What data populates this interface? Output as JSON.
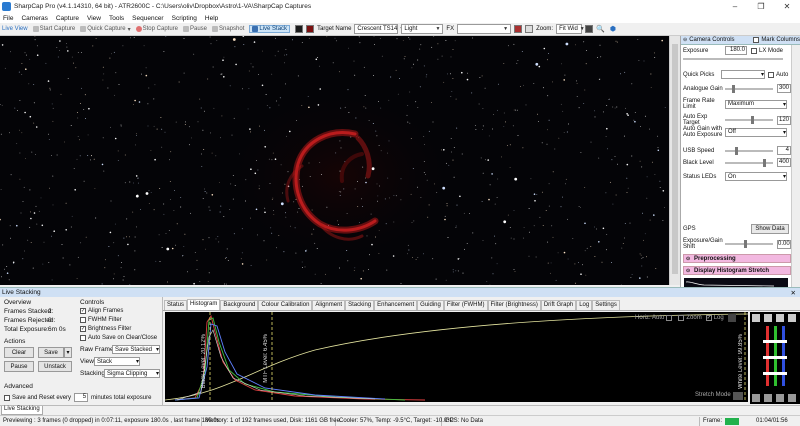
{
  "window": {
    "title": "SharpCap Pro (v4.1.14310, 64 bit) - ATR2600C - C:\\Users\\oliv\\Dropbox\\Astro\\1-VA\\SharpCap Captures",
    "minimize": "–",
    "maximize": "❐",
    "close": "✕"
  },
  "menu": [
    "File",
    "Cameras",
    "Capture",
    "View",
    "Tools",
    "Sequencer",
    "Scripting",
    "Help"
  ],
  "toolbar": {
    "live_view": "Live View",
    "start_capture": "Start Capture",
    "quick_capture": "Quick Capture",
    "stop_capture": "Stop Capture",
    "pause": "Pause",
    "snapshot": "Snapshot",
    "live_stack": "Live Stack",
    "target_label": "Target Name",
    "target_value": "Crescent TS14",
    "frame_type": "Light",
    "fx_label": "FX",
    "fx_value": "",
    "zoom_label": "Zoom:",
    "zoom_value": "Fit Wid"
  },
  "camera_controls": {
    "header": "Camera Controls",
    "mark_columns": "Mark Columns",
    "exposure_label": "Exposure",
    "exposure_value": "180.0",
    "lx_mode": "LX Mode",
    "quick_picks_label": "Quick Picks",
    "quick_picks_value": "",
    "auto_label": "Auto",
    "rows": [
      {
        "label": "Analogue Gain",
        "value": "300",
        "kind": "slider",
        "pos": 0.15
      },
      {
        "label": "Frame Rate Limit",
        "value": "Maximum",
        "kind": "combo"
      },
      {
        "label": "Auto Exp Target",
        "value": "120",
        "kind": "slider",
        "pos": 0.55
      },
      {
        "label": "Auto Gain with Auto Exposure",
        "value": "Off",
        "kind": "combo"
      },
      {
        "label": "USB Speed",
        "value": "4",
        "kind": "slider",
        "pos": 0.2
      },
      {
        "label": "Black Level",
        "value": "400",
        "kind": "slider",
        "pos": 0.8
      },
      {
        "label": "Status LEDs",
        "value": "On",
        "kind": "combo"
      }
    ],
    "gps_label": "GPS",
    "show_data": "Show Data",
    "exp_gain_shift_label": "Exposure/Gain Shift",
    "exp_gain_shift_value": "0.00",
    "preprocessing": "Preprocessing",
    "display_stretch": "Display Histogram Stretch"
  },
  "live_stacking": {
    "title": "Live Stacking",
    "overview": "Overview",
    "frames_stacked_label": "Frames Stacked:",
    "frames_stacked": "2",
    "frames_rejected_label": "Frames Rejected:",
    "frames_rejected": "0",
    "total_exposure_label": "Total Exposure:",
    "total_exposure": "6m 0s",
    "actions": "Actions",
    "clear": "Clear",
    "save": "Save",
    "pause": "Pause",
    "unstack": "Unstack",
    "advanced": "Advanced",
    "save_reset_label": "Save and Reset every",
    "save_reset_value": "5",
    "minutes_label": "minutes total exposure",
    "controls": "Controls",
    "align_frames": "Align Frames",
    "fwhm_filter": "FWHM Filter",
    "brightness_filter": "Brightness Filter",
    "auto_save": "Auto Save on Clear/Close",
    "raw_frames_label": "Raw Frames",
    "raw_frames_value": "Save Stacked",
    "view_label": "View",
    "view_value": "Stack",
    "stacking_label": "Stacking",
    "stacking_value": "Sigma Clipping"
  },
  "tabs": [
    "Status",
    "Histogram",
    "Background",
    "Colour Calibration",
    "Alignment",
    "Stacking",
    "Enhancement",
    "Guiding",
    "Filter (FWHM)",
    "Filter (Brightness)",
    "Drift Graph",
    "Log",
    "Settings"
  ],
  "histogram": {
    "black_level_label": "Black Level: 20.12%",
    "mid_level_label": "MTF Level: 6.45%",
    "white_level_label": "White Level: 99.85%",
    "horiz_auto": "Horiz. Auto",
    "zoom": "Zoom",
    "log": "Log",
    "stretch_mode": "Stretch Mode"
  },
  "bottom_tab": "Live Stacking",
  "status": {
    "previewing": "Previewing : 3 frames (0 dropped) in 0:07:11, exposure 180.0s , last frame 180.0s",
    "memory": "Memory: 1 of 192 frames used, Disk: 1161 GB free",
    "cooler": "Cooler: 57%, Temp: -9.5°C, Target: -10.0°C",
    "gps": "GPS: No Data",
    "frame_label": "Frame:",
    "time": "01:04/01:56"
  }
}
